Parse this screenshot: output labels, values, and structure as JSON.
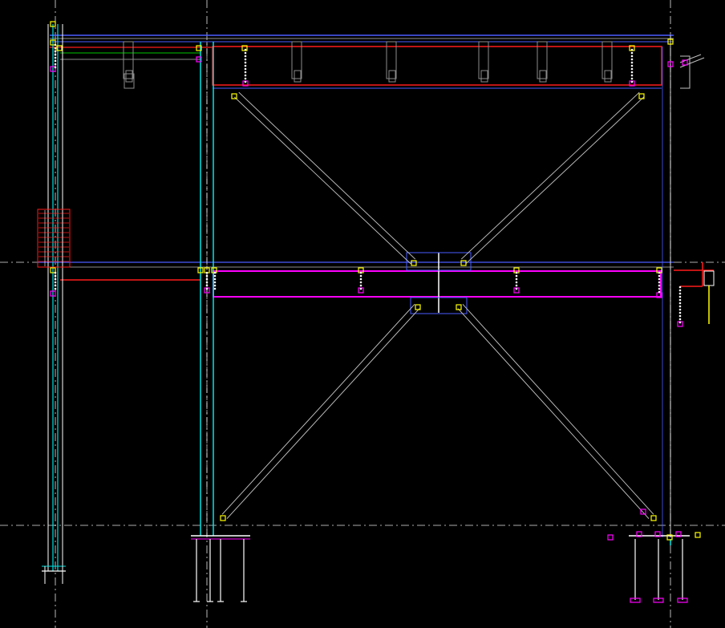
{
  "viewport": {
    "title": ""
  },
  "colors": {
    "background": "#000000",
    "centerline": "#e6e6e6",
    "column": "#00e5e5",
    "member_outline": "#ffffff",
    "brace": "#c8c8c8",
    "beam_red": "#ff1a1a",
    "beam_magenta": "#ff00ff",
    "blue_line": "#4a5cff",
    "green": "#00c800",
    "gray": "#8c8c8c",
    "marker_yellow": "#ffff00",
    "marker_magenta": "#ff00ff",
    "accent_yellow": "#ffff00"
  },
  "legend_note": ""
}
